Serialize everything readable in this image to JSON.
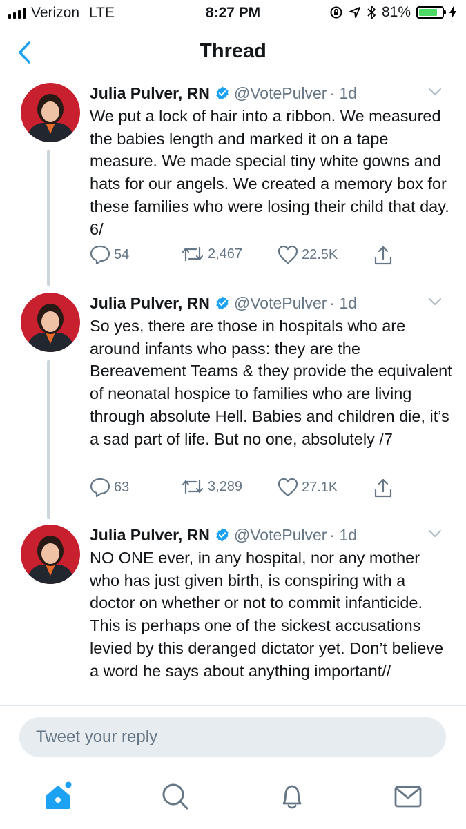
{
  "status_bar": {
    "carrier": "Verizon",
    "network": "LTE",
    "time": "8:27 PM",
    "battery": "81%",
    "battery_level": 0.81
  },
  "nav": {
    "title": "Thread",
    "back_icon": "chevron-left-icon"
  },
  "tweets": [
    {
      "name": "Julia Pulver, RN",
      "handle": "@VotePulver",
      "time": "· 1d",
      "text": "We put a lock of hair into a ribbon. We measured the babies length and marked it on a tape measure. We made special tiny white gowns and hats for our angels. We created a memory box for these families who were losing their child that day. 6/",
      "replies": "54",
      "retweets": "2,467",
      "likes": "22.5K"
    },
    {
      "name": "Julia Pulver, RN",
      "handle": "@VotePulver",
      "time": "· 1d",
      "text": "So yes, there are those in hospitals who are around infants who pass: they are the Bereavement Teams & they provide the equivalent of neonatal hospice to families who are living through absolute Hell. Babies and children die, it’s a sad part of life. But no one, absolutely /7",
      "replies": "63",
      "retweets": "3,289",
      "likes": "27.1K"
    },
    {
      "name": "Julia Pulver, RN",
      "handle": "@VotePulver",
      "time": "· 1d",
      "text": "NO ONE ever, in any hospital, nor any mother who has just given birth, is conspiring with a doctor on whether or not to commit infanticide. This is perhaps one of the sickest accusations levied by this deranged dictator yet. Don’t believe a word he says about anything important//"
    }
  ],
  "reply": {
    "placeholder": "Tweet your reply"
  },
  "tabbar": {
    "items": [
      "home-icon",
      "search-icon",
      "notifications-icon",
      "messages-icon"
    ]
  },
  "colors": {
    "accent": "#1da1f2",
    "muted": "#657786",
    "divider": "#e1e8ed",
    "avatar_bg": "#c8202f"
  }
}
